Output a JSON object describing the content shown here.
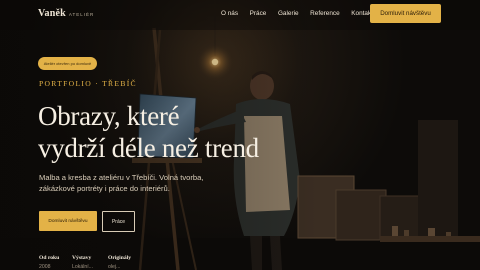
{
  "colors": {
    "accent": "#e3b247",
    "background": "#100d0a",
    "text": "#f6efe3"
  },
  "brand": {
    "name": "Vaněk",
    "subtitle": "ATELIÉR"
  },
  "nav": {
    "links": [
      "O nás",
      "Práce",
      "Galerie",
      "Reference",
      "Kontakt"
    ],
    "cta_label": "Domluvit návštěvu"
  },
  "hero": {
    "badge": "Ateliér otevřen po domluvě",
    "eyebrow": "PORTFOLIO · TŘEBÍČ",
    "headline_lines": [
      "Obrazy, které",
      "vydrží déle než trend"
    ],
    "lead": "Malba a kresba z ateliéru v Třebíči. Volná tvorba, zákázkové portréty i práce do interiérů.",
    "primary_button": "Domluvit návštěvu",
    "secondary_button": "Práce"
  },
  "stats": [
    {
      "label": "Od roku",
      "value": "2008"
    },
    {
      "label": "Výstavy",
      "value": "Lokální..."
    },
    {
      "label": "Originály",
      "value": "olej..."
    }
  ],
  "background_image": {
    "subject": "painter-at-easel-photo"
  }
}
